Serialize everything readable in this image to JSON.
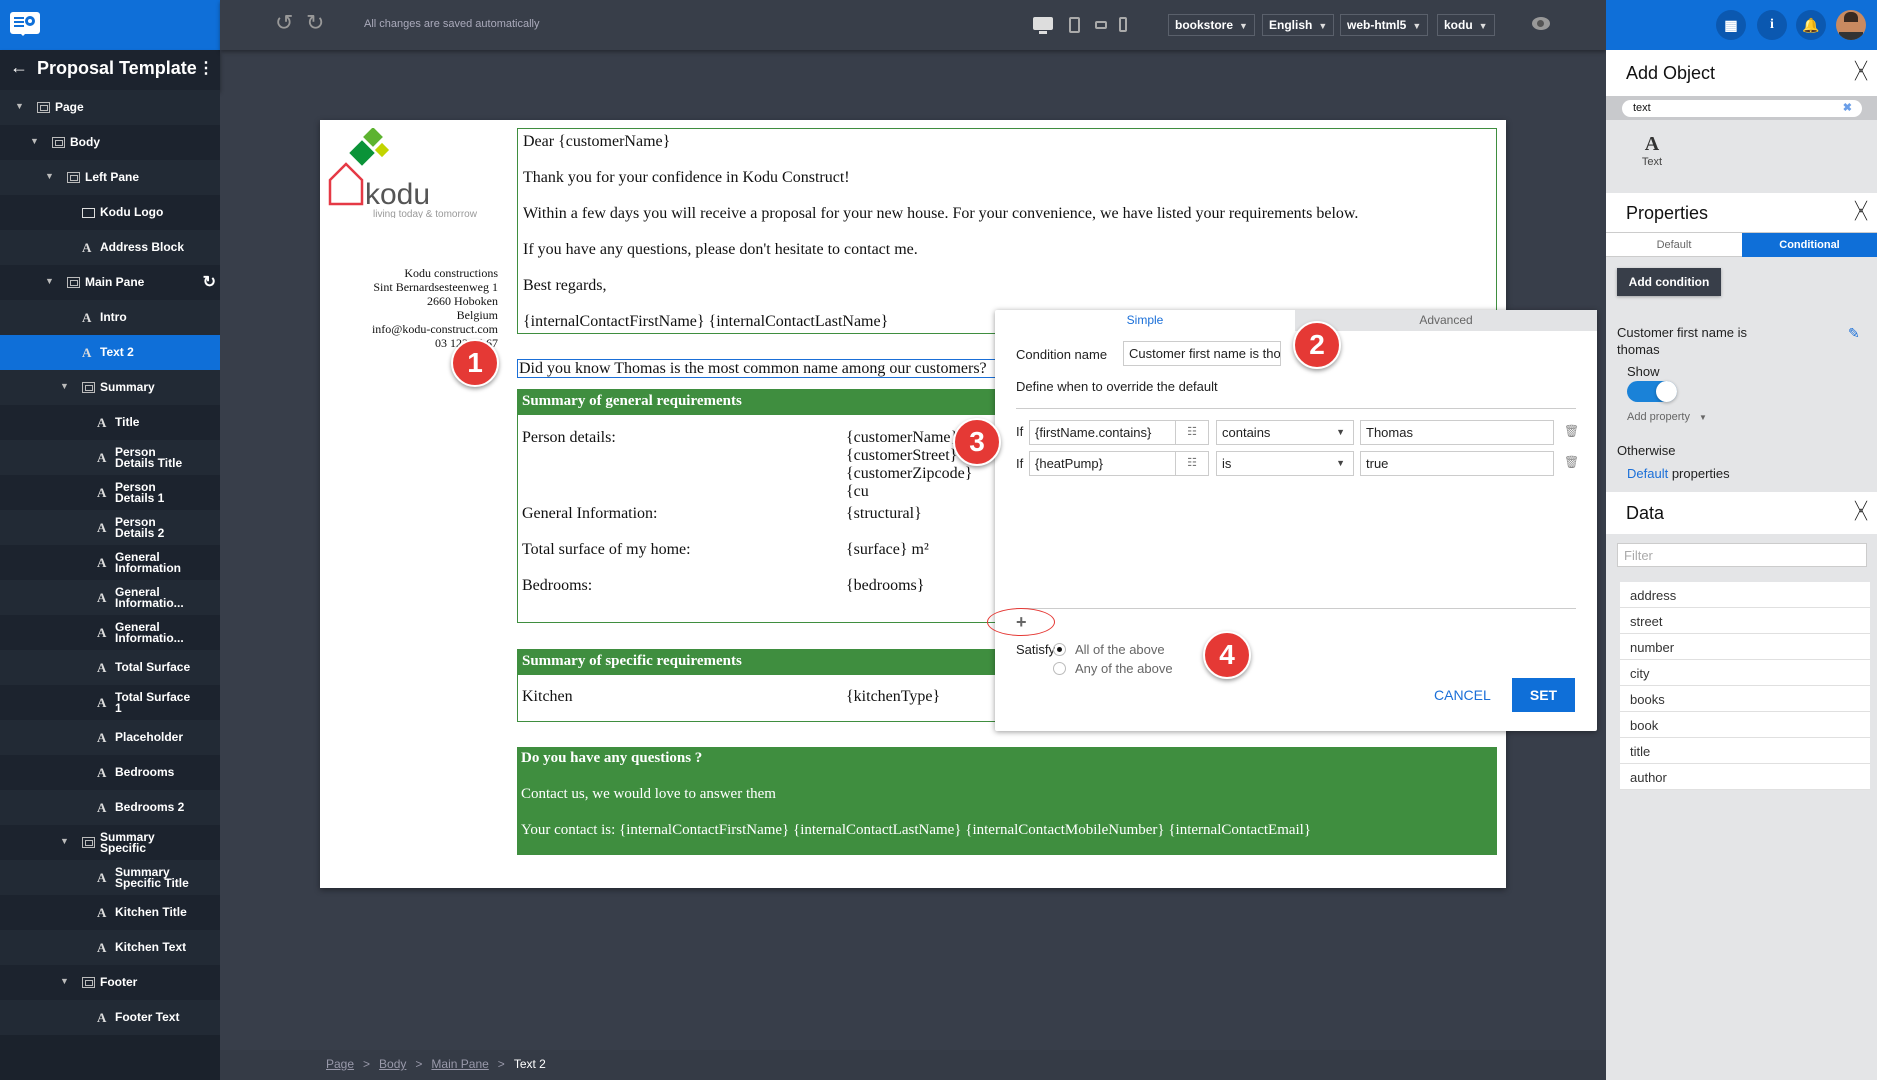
{
  "sidebar": {
    "title": "Proposal Template",
    "tree": [
      {
        "label": "Page",
        "type": "container",
        "depth": 0,
        "expanded": true
      },
      {
        "label": "Body",
        "type": "container",
        "depth": 1,
        "expanded": true
      },
      {
        "label": "Left Pane",
        "type": "container",
        "depth": 2,
        "expanded": true
      },
      {
        "label": "Kodu Logo",
        "type": "image",
        "depth": 3
      },
      {
        "label": "Address Block",
        "type": "text",
        "depth": 3
      },
      {
        "label": "Main Pane",
        "type": "container",
        "depth": 2,
        "expanded": true,
        "refresh": true
      },
      {
        "label": "Intro",
        "type": "text",
        "depth": 3
      },
      {
        "label": "Text 2",
        "type": "text",
        "depth": 3,
        "selected": true
      },
      {
        "label": "Summary",
        "type": "container",
        "depth": 3,
        "expanded": true
      },
      {
        "label": "Title",
        "type": "text",
        "depth": 4
      },
      {
        "label": "Person\nDetails Title",
        "type": "text",
        "depth": 4
      },
      {
        "label": "Person\nDetails 1",
        "type": "text",
        "depth": 4
      },
      {
        "label": "Person\nDetails 2",
        "type": "text",
        "depth": 4
      },
      {
        "label": "General\nInformation",
        "type": "text",
        "depth": 4
      },
      {
        "label": "General\nInformatio...",
        "type": "text",
        "depth": 4
      },
      {
        "label": "General\nInformatio...",
        "type": "text",
        "depth": 4
      },
      {
        "label": "Total Surface",
        "type": "text",
        "depth": 4
      },
      {
        "label": "Total Surface\n1",
        "type": "text",
        "depth": 4
      },
      {
        "label": "Placeholder",
        "type": "text",
        "depth": 4
      },
      {
        "label": "Bedrooms",
        "type": "text",
        "depth": 4
      },
      {
        "label": "Bedrooms 2",
        "type": "text",
        "depth": 4
      },
      {
        "label": "Summary\nSpecific",
        "type": "container",
        "depth": 3,
        "expanded": true
      },
      {
        "label": "Summary\nSpecific Title",
        "type": "text",
        "depth": 4
      },
      {
        "label": "Kitchen Title",
        "type": "text",
        "depth": 4
      },
      {
        "label": "Kitchen Text",
        "type": "text",
        "depth": 4
      },
      {
        "label": "Footer",
        "type": "container",
        "depth": 3,
        "expanded": true
      },
      {
        "label": "Footer Text",
        "type": "text",
        "depth": 4
      }
    ]
  },
  "toolbar": {
    "save_status": "All changes are saved automatically",
    "selects": [
      "bookstore",
      "English",
      "web-html5",
      "kodu"
    ]
  },
  "document": {
    "logo": {
      "name": "kodu",
      "tagline": "living today & tomorrow"
    },
    "address": [
      "Kodu constructions",
      "Sint Bernardsesteenweg 1",
      "2660 Hoboken",
      "Belgium",
      "info@kodu-construct.com",
      "03 123 45 67"
    ],
    "intro": [
      "Dear {customerName}",
      "Thank you for your confidence in Kodu Construct!",
      "Within a few days you will receive a proposal for your new house. For your convenience, we have listed your requirements below.",
      "If you have any questions, please don't hesitate to contact me.",
      "Best regards,",
      "{internalContactFirstName} {internalContactLastName}"
    ],
    "text2": "Did you know Thomas is the most common name among our customers?",
    "summary": {
      "title": "Summary of general requirements",
      "rows": [
        {
          "label": "Person details:",
          "value": "{customerName} {customerStreet} {customerZipcode} {cu\n{companyCountry}"
        },
        {
          "label": "General Information:",
          "value": "{structural}"
        },
        {
          "label": "Total surface of my home:",
          "value": "{surface} m²"
        },
        {
          "label": "Bedrooms:",
          "value": "{bedrooms}"
        }
      ]
    },
    "specific": {
      "title": "Summary of specific requirements",
      "rows": [
        {
          "label": "Kitchen",
          "value": "{kitchenType}"
        }
      ]
    },
    "footer": [
      "Do you have any questions ?",
      "Contact us, we would love to answer them",
      "Your contact is: {internalContactFirstName} {internalContactLastName} {internalContactMobileNumber} {internalContactEmail}"
    ]
  },
  "condition_dialog": {
    "tabs": [
      "Simple",
      "Advanced"
    ],
    "active_tab": "Simple",
    "condition_name_label": "Condition name",
    "condition_name_value": "Customer first name is thomas",
    "define_label": "Define when to override the default",
    "if_label": "If",
    "rules": [
      {
        "field": "{firstName.contains}",
        "operator": "contains",
        "value": "Thomas"
      },
      {
        "field": "{heatPump}",
        "operator": "is",
        "value": "true"
      }
    ],
    "add_label": "+",
    "satisfy_label": "Satisfy",
    "satisfy_options": [
      "All of the above",
      "Any of the above"
    ],
    "satisfy_selected": "All of the above",
    "cancel_label": "CANCEL",
    "set_label": "SET"
  },
  "annotations": [
    "1",
    "2",
    "3",
    "4"
  ],
  "right_panel": {
    "add_object": {
      "title": "Add Object",
      "search_value": "text",
      "result_label": "Text"
    },
    "properties": {
      "title": "Properties",
      "tabs": [
        "Default",
        "Conditional"
      ],
      "active_tab": "Conditional",
      "add_condition_label": "Add condition",
      "condition_name": "Customer first name is thomas",
      "show_label": "Show",
      "show_enabled": true,
      "add_property_label": "Add property",
      "otherwise_label": "Otherwise",
      "default_link": "Default",
      "properties_suffix": "properties"
    },
    "data": {
      "title": "Data",
      "filter_placeholder": "Filter",
      "items": [
        "address",
        "street",
        "number",
        "city",
        "books",
        "book",
        "title",
        "author"
      ]
    }
  },
  "breadcrumb": [
    "Page",
    "Body",
    "Main Pane",
    "Text 2"
  ],
  "colors": {
    "brand": "#0f6fd8",
    "green": "#3f8e3f",
    "annotation": "#e53935"
  }
}
